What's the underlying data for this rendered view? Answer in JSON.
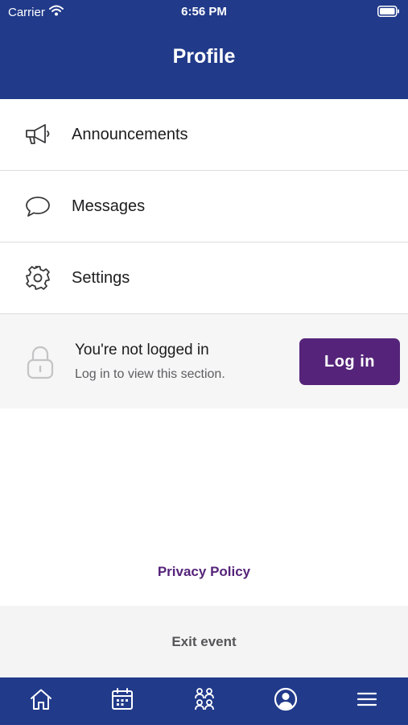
{
  "status_bar": {
    "carrier": "Carrier",
    "time": "6:56 PM",
    "wifi_icon": "wifi-icon",
    "battery_icon": "battery-icon"
  },
  "header": {
    "title": "Profile"
  },
  "menu": {
    "items": [
      {
        "label": "Announcements",
        "icon": "megaphone-icon"
      },
      {
        "label": "Messages",
        "icon": "chat-bubble-icon"
      },
      {
        "label": "Settings",
        "icon": "gear-icon"
      }
    ]
  },
  "login_card": {
    "icon": "lock-icon",
    "title": "You're not logged in",
    "subtitle": "Log in to view this section.",
    "button_label": "Log in"
  },
  "footer": {
    "privacy_label": "Privacy Policy",
    "exit_label": "Exit event"
  },
  "tab_bar": {
    "tabs": [
      {
        "icon": "home-icon"
      },
      {
        "icon": "calendar-icon"
      },
      {
        "icon": "people-icon"
      },
      {
        "icon": "profile-icon",
        "active": true
      },
      {
        "icon": "menu-icon"
      }
    ]
  },
  "colors": {
    "header_bg": "#213a8a",
    "accent": "#55247a",
    "card_bg": "#f6f6f6"
  }
}
